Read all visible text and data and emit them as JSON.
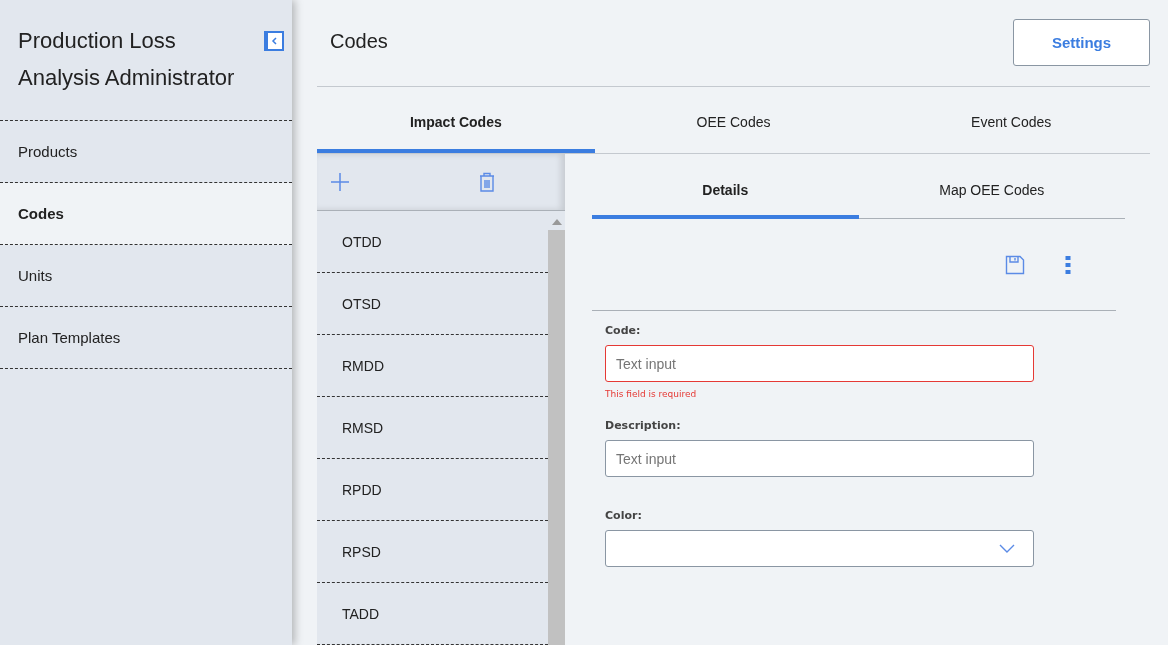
{
  "sidebar": {
    "title": "Production Loss Analysis Administrator",
    "items": [
      {
        "label": "Products",
        "selected": false
      },
      {
        "label": "Codes",
        "selected": true
      },
      {
        "label": "Units",
        "selected": false
      },
      {
        "label": "Plan Templates",
        "selected": false
      }
    ]
  },
  "header": {
    "title": "Codes",
    "button": "Settings"
  },
  "tabs": [
    {
      "label": "Impact Codes",
      "selected": true
    },
    {
      "label": "OEE Codes",
      "selected": false
    },
    {
      "label": "Event Codes",
      "selected": false
    }
  ],
  "code_list": [
    {
      "label": "OTDD",
      "selected": false
    },
    {
      "label": "OTSD",
      "selected": false
    },
    {
      "label": "RMDD",
      "selected": false
    },
    {
      "label": "RMSD",
      "selected": false
    },
    {
      "label": "RPDD",
      "selected": false
    },
    {
      "label": "RPSD",
      "selected": false
    },
    {
      "label": "TADD",
      "selected": false
    }
  ],
  "detail_tabs": [
    {
      "label": "Details",
      "selected": true
    },
    {
      "label": "Map OEE Codes",
      "selected": false
    }
  ],
  "fields": [
    {
      "kind": "text",
      "label": "Code:",
      "placeholder": "Text input",
      "error": "This field is required"
    },
    {
      "kind": "text",
      "label": "Description:",
      "placeholder": "Text input"
    },
    {
      "kind": "select",
      "label": "Color:"
    }
  ]
}
